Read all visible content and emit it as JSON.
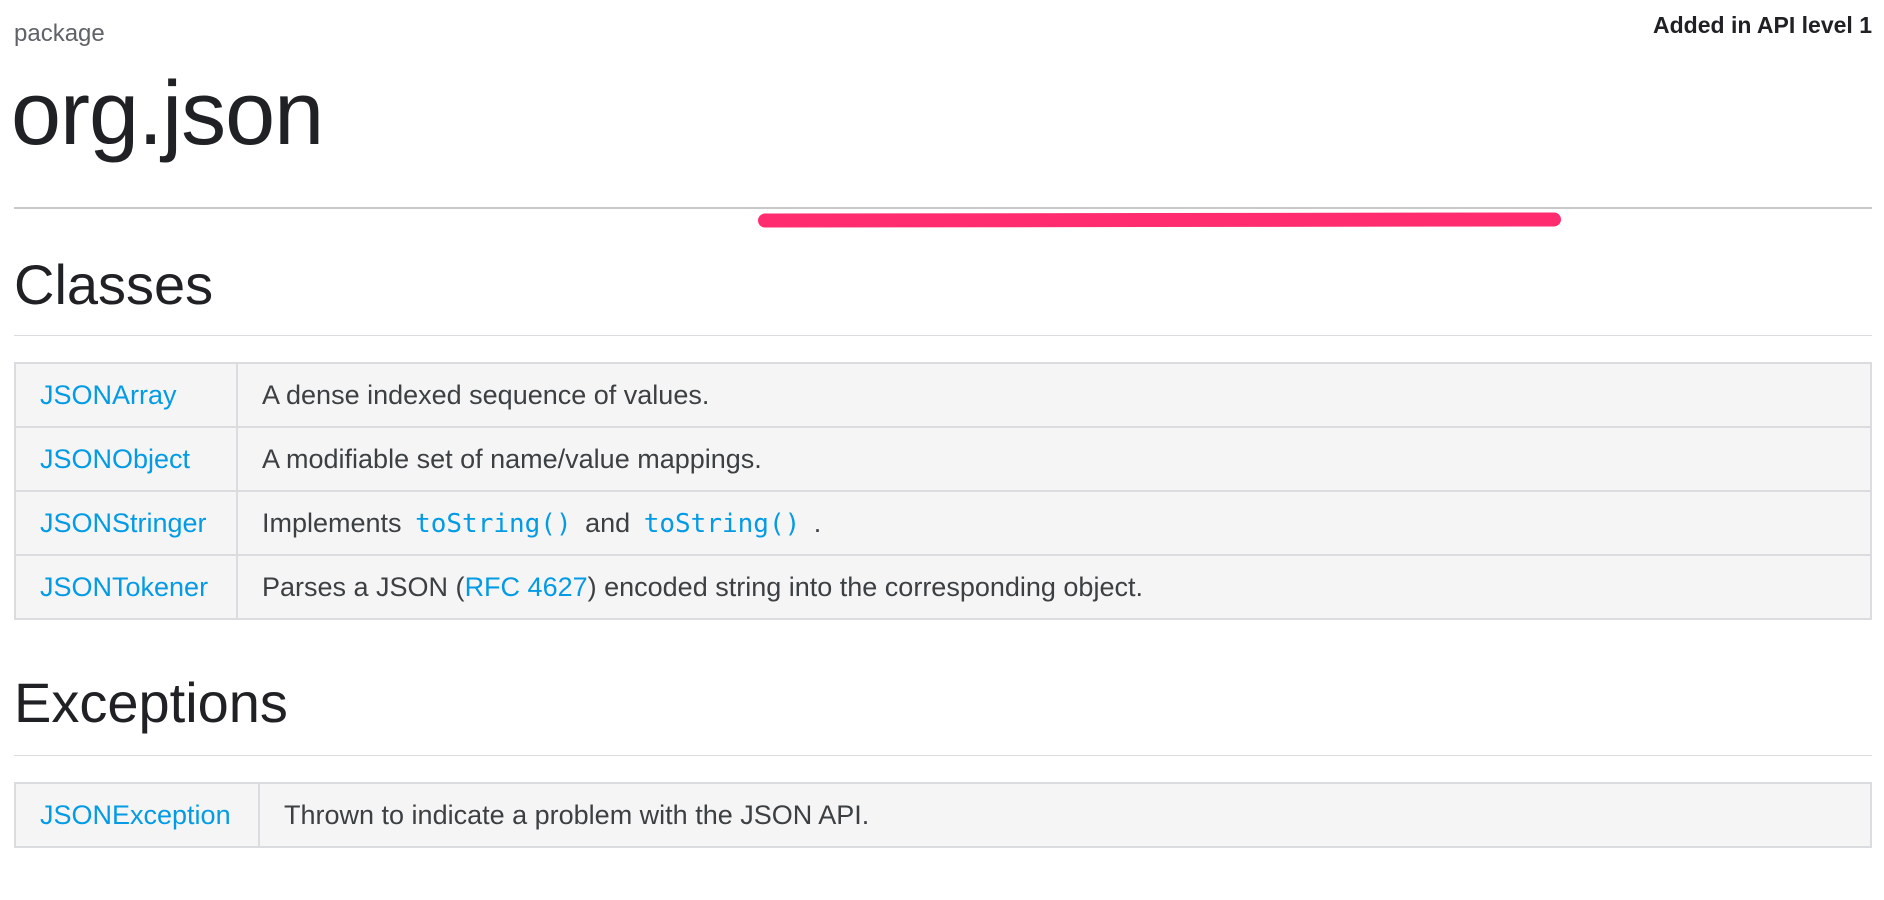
{
  "header": {
    "eyebrow": "package",
    "title": "org.json",
    "api_level": "Added in API level 1"
  },
  "highlight": {
    "color": "#ff2d6f"
  },
  "classes": {
    "heading": "Classes",
    "rows": [
      {
        "name": "JSONArray",
        "description": "A dense indexed sequence of values."
      },
      {
        "name": "JSONObject",
        "description": "A modifiable set of name/value mappings."
      },
      {
        "name": "JSONStringer",
        "desc_prefix": "Implements",
        "desc_code_1": "toString()",
        "desc_middle": "and",
        "desc_code_2": "toString()",
        "desc_suffix": "."
      },
      {
        "name": "JSONTokener",
        "desc_prefix": "Parses a JSON (",
        "desc_link": "RFC 4627",
        "desc_suffix": ") encoded string into the corresponding object."
      }
    ]
  },
  "exceptions": {
    "heading": "Exceptions",
    "rows": [
      {
        "name": "JSONException",
        "description": "Thrown to indicate a problem with the JSON API."
      }
    ]
  },
  "colors": {
    "link": "#039be5",
    "table_bg": "#f5f5f5",
    "border": "#dadce0"
  }
}
